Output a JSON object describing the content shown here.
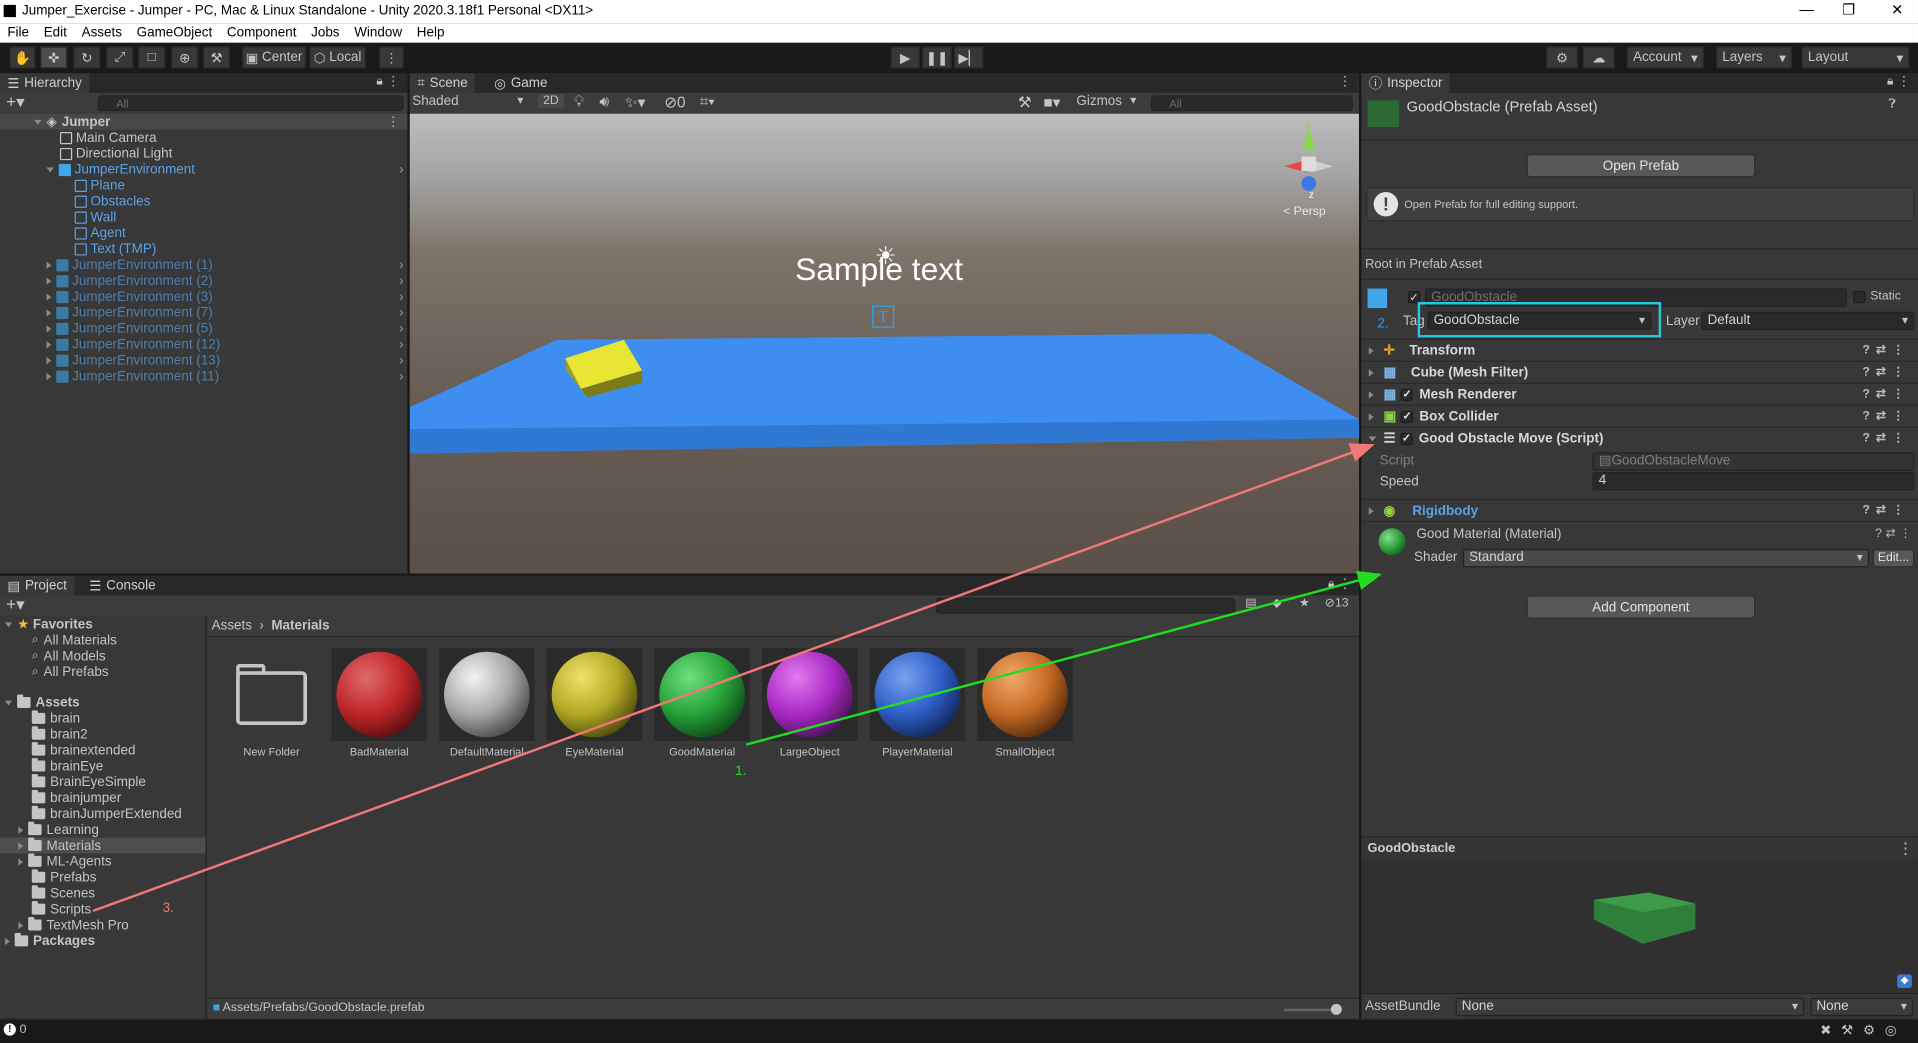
{
  "window": {
    "title": "Jumper_Exercise - Jumper - PC, Mac & Linux Standalone - Unity 2020.3.18f1 Personal <DX11>"
  },
  "menu": [
    "File",
    "Edit",
    "Assets",
    "GameObject",
    "Component",
    "Jobs",
    "Window",
    "Help"
  ],
  "toolbar": {
    "center": "Center",
    "local": "Local",
    "account": "Account",
    "layers": "Layers",
    "layout": "Layout"
  },
  "hierarchy": {
    "tab": "Hierarchy",
    "search_placeholder": "All",
    "scene": "Jumper",
    "items": [
      {
        "label": "Main Camera"
      },
      {
        "label": "Directional Light"
      },
      {
        "label": "JumperEnvironment"
      },
      {
        "label": "Plane"
      },
      {
        "label": "Obstacles"
      },
      {
        "label": "Wall"
      },
      {
        "label": "Agent"
      },
      {
        "label": "Text (TMP)"
      },
      {
        "label": "JumperEnvironment (1)"
      },
      {
        "label": "JumperEnvironment (2)"
      },
      {
        "label": "JumperEnvironment (3)"
      },
      {
        "label": "JumperEnvironment (7)"
      },
      {
        "label": "JumperEnvironment (5)"
      },
      {
        "label": "JumperEnvironment (12)"
      },
      {
        "label": "JumperEnvironment (13)"
      },
      {
        "label": "JumperEnvironment (11)"
      }
    ]
  },
  "scene_view": {
    "tabs": [
      "Scene",
      "Game"
    ],
    "shading": "Shaded",
    "mode_2d": "2D",
    "hidden_count": "0",
    "gizmos": "Gizmos",
    "search_placeholder": "All",
    "sample_text": "Sample text",
    "persp": "< Persp",
    "axis_y": "y",
    "axis_z": "z"
  },
  "project": {
    "tabs": [
      "Project",
      "Console"
    ],
    "favorites": {
      "label": "Favorites",
      "items": [
        "All Materials",
        "All Models",
        "All Prefabs"
      ]
    },
    "assets_label": "Assets",
    "folders": [
      "brain",
      "brain2",
      "brainextended",
      "brainEye",
      "BrainEyeSimple",
      "brainjumper",
      "brainJumperExtended",
      "Learning",
      "Materials",
      "ML-Agents",
      "Prefabs",
      "Scenes",
      "Scripts",
      "TextMesh Pro"
    ],
    "packages_label": "Packages",
    "breadcrumb": [
      "Assets",
      "Materials"
    ],
    "hidden_count": "13",
    "items": [
      {
        "name": "New Folder",
        "type": "folder"
      },
      {
        "name": "BadMaterial",
        "color": "#c0262a"
      },
      {
        "name": "DefaultMaterial",
        "color": "#d6d6d6"
      },
      {
        "name": "EyeMaterial",
        "color": "#cfc52a"
      },
      {
        "name": "GoodMaterial",
        "color": "#27a33a"
      },
      {
        "name": "LargeObject",
        "color": "#b52ad0"
      },
      {
        "name": "PlayerMaterial",
        "color": "#2d5fc8"
      },
      {
        "name": "SmallObject",
        "color": "#d6742a"
      }
    ],
    "status_path": "Assets/Prefabs/GoodObstacle.prefab"
  },
  "inspector": {
    "tab": "Inspector",
    "asset_title": "GoodObstacle (Prefab Asset)",
    "open_prefab": "Open Prefab",
    "info_text": "Open Prefab for full editing support.",
    "root_label": "Root in Prefab Asset",
    "object_name": "GoodObstacle",
    "static_label": "Static",
    "tag_label": "Tag",
    "tag_value": "GoodObstacle",
    "layer_label": "Layer",
    "layer_value": "Default",
    "components": [
      {
        "name": "Transform"
      },
      {
        "name": "Cube (Mesh Filter)"
      },
      {
        "name": "Mesh Renderer"
      },
      {
        "name": "Box Collider"
      },
      {
        "name": "Good Obstacle Move (Script)"
      }
    ],
    "script_label": "Script",
    "script_value": "GoodObstacleMove",
    "speed_label": "Speed",
    "speed_value": "4",
    "rigidbody": "Rigidbody",
    "material_name": "Good Material (Material)",
    "shader_label": "Shader",
    "shader_value": "Standard",
    "edit_btn": "Edit...",
    "add_component": "Add Component",
    "preview_title": "GoodObstacle",
    "assetbundle_label": "AssetBundle",
    "assetbundle_value": "None",
    "assetbundle_variant": "None"
  },
  "annotations": {
    "step1": "1.",
    "step2": "2.",
    "step3": "3."
  },
  "statusbar": {
    "count": "0"
  }
}
